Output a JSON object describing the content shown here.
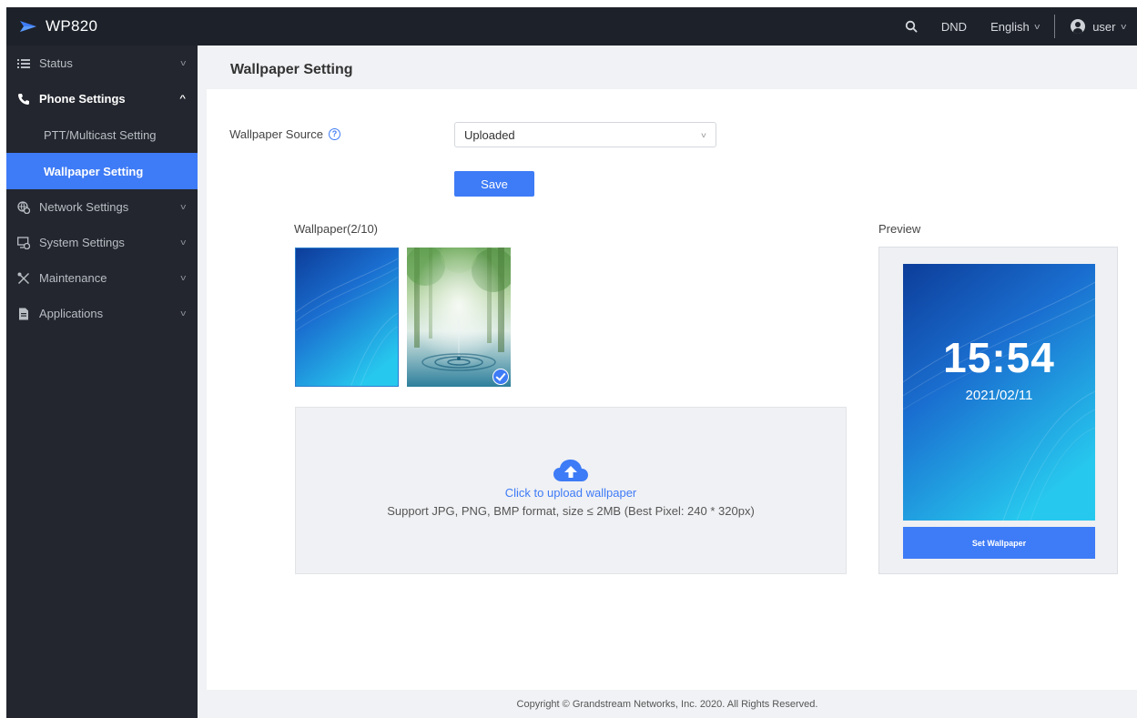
{
  "app": {
    "title": "WP820"
  },
  "topbar": {
    "dnd_label": "DND",
    "language": "English",
    "user": "user",
    "icons": [
      "logo-icon",
      "search-icon",
      "user-avatar-icon",
      "chevron-down-icon"
    ]
  },
  "sidebar": {
    "items": [
      {
        "label": "Status",
        "icon": "list-icon",
        "expanded": false
      },
      {
        "label": "Phone Settings",
        "icon": "phone-icon",
        "expanded": true,
        "children": [
          {
            "label": "PTT/Multicast Setting",
            "active": false
          },
          {
            "label": "Wallpaper Setting",
            "active": true
          }
        ]
      },
      {
        "label": "Network Settings",
        "icon": "network-icon",
        "expanded": false
      },
      {
        "label": "System Settings",
        "icon": "system-icon",
        "expanded": false
      },
      {
        "label": "Maintenance",
        "icon": "tools-icon",
        "expanded": false
      },
      {
        "label": "Applications",
        "icon": "document-icon",
        "expanded": false
      }
    ]
  },
  "page": {
    "title": "Wallpaper Setting"
  },
  "form": {
    "source_label": "Wallpaper Source",
    "source_value": "Uploaded",
    "save_label": "Save"
  },
  "wallpapers": {
    "title": "Wallpaper(2/10)",
    "selected_index": 1
  },
  "upload": {
    "link": "Click to upload wallpaper",
    "hint": "Support JPG, PNG, BMP format, size ≤ 2MB (Best Pixel: 240 * 320px)"
  },
  "preview": {
    "title": "Preview",
    "time": "15:54",
    "date": "2021/02/11",
    "button": "Set Wallpaper"
  },
  "footer": {
    "text": "Copyright © Grandstream Networks, Inc. 2020. All Rights Reserved."
  },
  "colors": {
    "accent": "#3e7bf6",
    "topbar_bg": "#1d2129",
    "sidebar_bg": "#23262e"
  }
}
